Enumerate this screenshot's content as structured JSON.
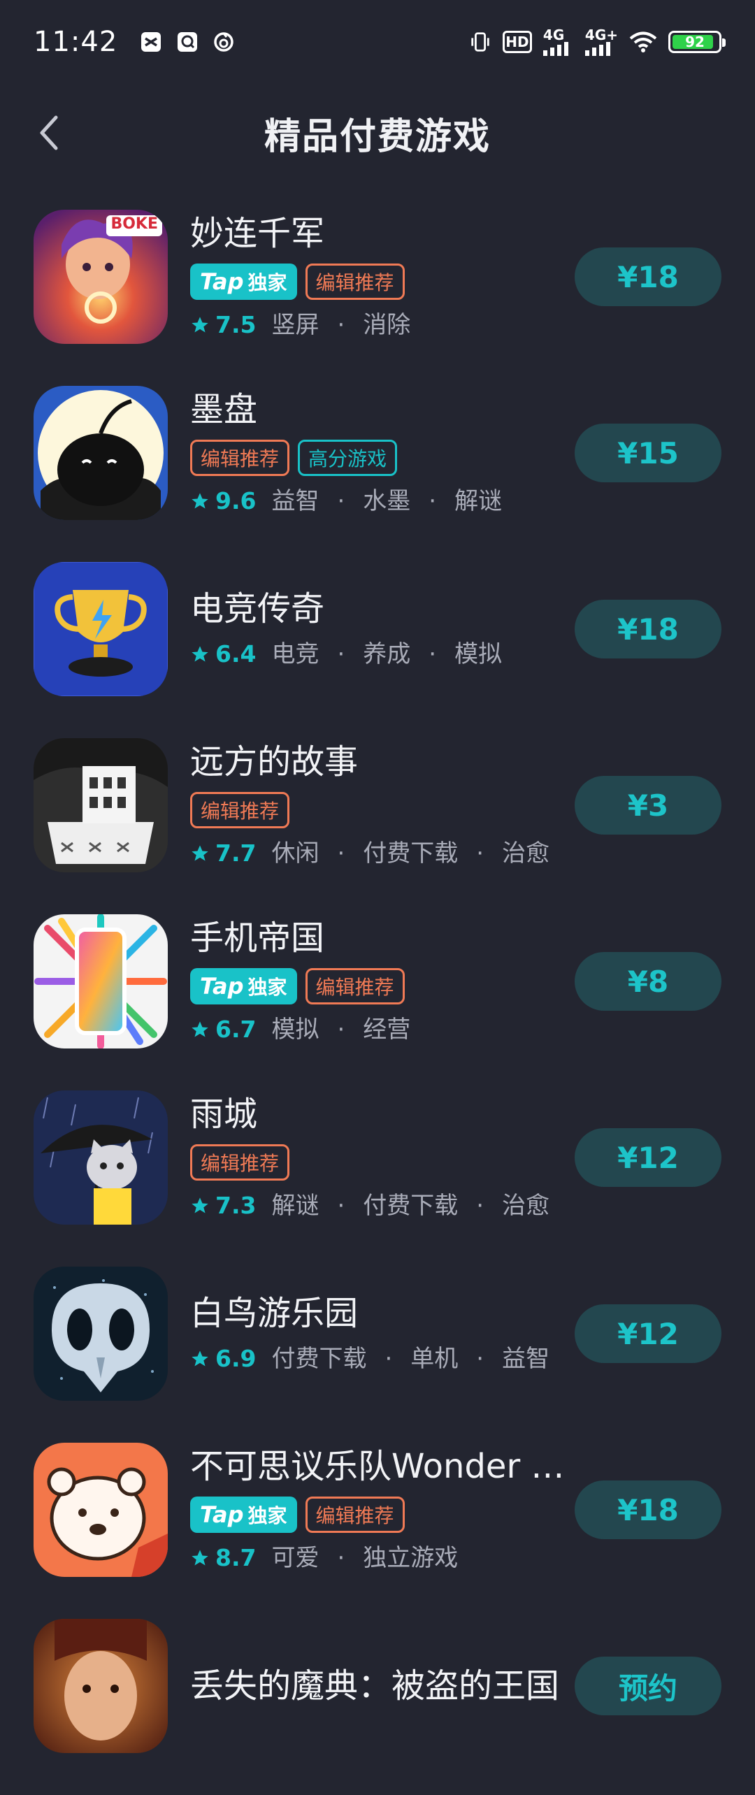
{
  "status": {
    "time": "11:42",
    "net1": "4G",
    "net2": "4G+",
    "hd": "HD",
    "battery": "92",
    "battery_level": 0.92
  },
  "header": {
    "title": "精品付费游戏"
  },
  "games": [
    {
      "name": "妙连千军",
      "tags": [
        {
          "type": "tap",
          "tap": "Tap",
          "label": "独家"
        },
        {
          "type": "editor",
          "label": "编辑推荐"
        }
      ],
      "rating": "7.5",
      "genres": [
        "竖屏",
        "消除"
      ],
      "price": "¥18",
      "icon_badge": "BOKE"
    },
    {
      "name": "墨盘",
      "tags": [
        {
          "type": "editor",
          "label": "编辑推荐"
        },
        {
          "type": "high",
          "label": "高分游戏"
        }
      ],
      "rating": "9.6",
      "genres": [
        "益智",
        "水墨",
        "解谜"
      ],
      "price": "¥15"
    },
    {
      "name": "电竞传奇",
      "tags": [],
      "rating": "6.4",
      "genres": [
        "电竞",
        "养成",
        "模拟"
      ],
      "price": "¥18"
    },
    {
      "name": "远方的故事",
      "tags": [
        {
          "type": "editor",
          "label": "编辑推荐"
        }
      ],
      "rating": "7.7",
      "genres": [
        "休闲",
        "付费下载",
        "治愈"
      ],
      "price": "¥3"
    },
    {
      "name": "手机帝国",
      "tags": [
        {
          "type": "tap",
          "tap": "Tap",
          "label": "独家"
        },
        {
          "type": "editor",
          "label": "编辑推荐"
        }
      ],
      "rating": "6.7",
      "genres": [
        "模拟",
        "经营"
      ],
      "price": "¥8"
    },
    {
      "name": "雨城",
      "tags": [
        {
          "type": "editor",
          "label": "编辑推荐"
        }
      ],
      "rating": "7.3",
      "genres": [
        "解谜",
        "付费下载",
        "治愈"
      ],
      "price": "¥12"
    },
    {
      "name": "白鸟游乐园",
      "tags": [],
      "rating": "6.9",
      "genres": [
        "付费下载",
        "单机",
        "益智"
      ],
      "price": "¥12"
    },
    {
      "name": "不可思议乐队Wonder …",
      "tags": [
        {
          "type": "tap",
          "tap": "Tap",
          "label": "独家"
        },
        {
          "type": "editor",
          "label": "编辑推荐"
        }
      ],
      "rating": "8.7",
      "genres": [
        "可爱",
        "独立游戏"
      ],
      "price": "¥18"
    },
    {
      "name": "丢失的魔典：被盗的王国",
      "tags": [],
      "rating": "",
      "genres": [],
      "price": "预约"
    }
  ],
  "colors": {
    "background": "#232530",
    "accent": "#19c2c8",
    "editor_tag": "#f07a55",
    "price_bg": "#23474f"
  },
  "icons": [
    "back-arrow-icon",
    "star-icon",
    "wifi-icon",
    "signal-icon",
    "vibrate-icon"
  ]
}
